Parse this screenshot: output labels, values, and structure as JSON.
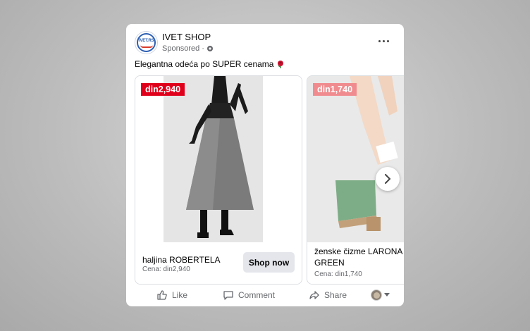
{
  "post": {
    "page_name": "IVET SHOP",
    "avatar_text": "IVET.RS",
    "sponsored": "Sponsored ·",
    "caption": "Elegantna odeća po SUPER cenama",
    "icons": {
      "globe": "globe-icon",
      "more": "more-options-icon",
      "rose": "rose-emoji-icon"
    }
  },
  "carousel": {
    "cards": [
      {
        "price": "din2,940",
        "price_color": "#e0001b",
        "title": "haljina ROBERTELA",
        "subtitle": "Cena: din2,940",
        "cta": "Shop now"
      },
      {
        "price": "din1,740",
        "price_color": "#f08c8f",
        "title": "ženske čizme LARONA GREEN",
        "subtitle": "Cena: din1,740"
      }
    ],
    "next_icon": "chevron-right-icon"
  },
  "actions": {
    "like": "Like",
    "comment": "Comment",
    "share": "Share"
  }
}
